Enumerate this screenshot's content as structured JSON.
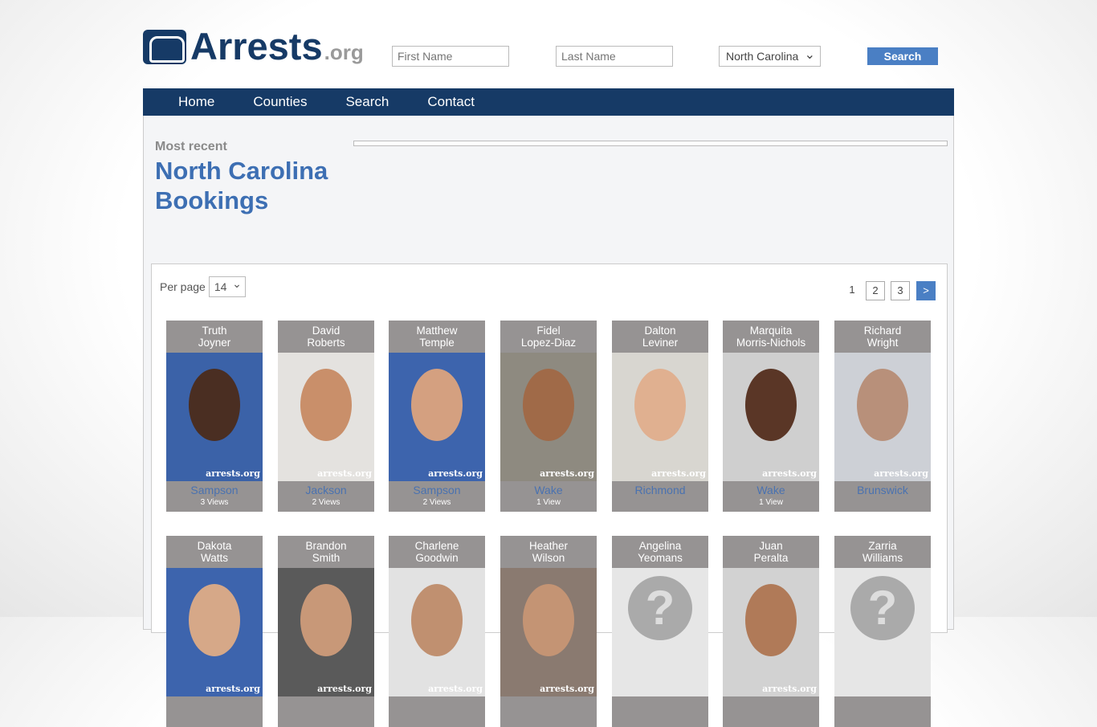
{
  "header": {
    "logo_text": "Arrests",
    "logo_suffix": ".org",
    "first_name_placeholder": "First Name",
    "last_name_placeholder": "Last Name",
    "state": "North Carolina",
    "search_label": "Search"
  },
  "nav": [
    "Home",
    "Counties",
    "Search",
    "Contact"
  ],
  "page": {
    "kicker": "Most recent",
    "title": "North Carolina Bookings"
  },
  "list": {
    "per_page_label": "Per page",
    "per_page": "14",
    "pages": [
      "1",
      "2",
      "3",
      ">"
    ],
    "current_page": "1"
  },
  "watermark": "arrests.org",
  "bookings": [
    {
      "first": "Truth",
      "last": "Joyner",
      "county": "Sampson",
      "views": "3 Views",
      "bg": "#3b62a8",
      "skin": "#4a2e22"
    },
    {
      "first": "David",
      "last": "Roberts",
      "county": "Jackson",
      "views": "2 Views",
      "bg": "#e4e2df",
      "skin": "#c98f6a"
    },
    {
      "first": "Matthew",
      "last": "Temple",
      "county": "Sampson",
      "views": "2 Views",
      "bg": "#3d64ad",
      "skin": "#d4a080"
    },
    {
      "first": "Fidel",
      "last": "Lopez-Diaz",
      "county": "Wake",
      "views": "1 View",
      "bg": "#8e8a80",
      "skin": "#a06a48"
    },
    {
      "first": "Dalton",
      "last": "Leviner",
      "county": "Richmond",
      "views": "",
      "bg": "#d8d6d0",
      "skin": "#e0b090"
    },
    {
      "first": "Marquita",
      "last": "Morris-Nichols",
      "county": "Wake",
      "views": "1 View",
      "bg": "#cfcfcf",
      "skin": "#5a3626"
    },
    {
      "first": "Richard",
      "last": "Wright",
      "county": "Brunswick",
      "views": "",
      "bg": "#cdd0d6",
      "skin": "#b8907a"
    },
    {
      "first": "Dakota",
      "last": "Watts",
      "county": "",
      "views": "",
      "bg": "#3d64ad",
      "skin": "#d6a888"
    },
    {
      "first": "Brandon",
      "last": "Smith",
      "county": "",
      "views": "",
      "bg": "#5a5a5a",
      "skin": "#c89878"
    },
    {
      "first": "Charlene",
      "last": "Goodwin",
      "county": "",
      "views": "",
      "bg": "#e2e2e2",
      "skin": "#c09070"
    },
    {
      "first": "Heather",
      "last": "Wilson",
      "county": "",
      "views": "",
      "bg": "#8a7a70",
      "skin": "#c49474"
    },
    {
      "first": "Angelina",
      "last": "Yeomans",
      "county": "",
      "views": "",
      "placeholder": true
    },
    {
      "first": "Juan",
      "last": "Peralta",
      "county": "",
      "views": "",
      "bg": "#d2d2d2",
      "skin": "#b07a58"
    },
    {
      "first": "Zarria",
      "last": "Williams",
      "county": "",
      "views": "",
      "placeholder": true
    }
  ]
}
